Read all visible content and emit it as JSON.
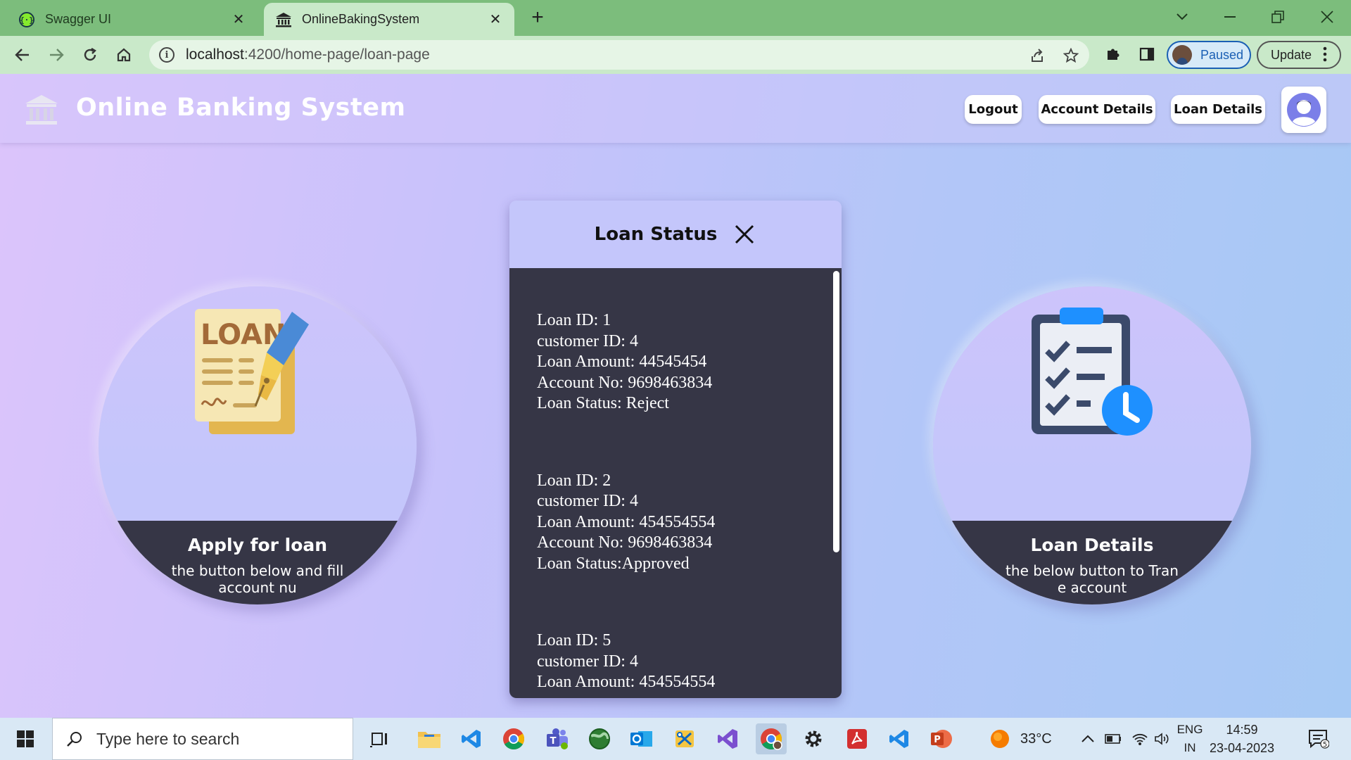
{
  "browser": {
    "tabs": [
      {
        "title": "Swagger UI",
        "active": false
      },
      {
        "title": "OnlineBakingSystem",
        "active": true
      }
    ],
    "url_host": "localhost",
    "url_path": ":4200/home-page/loan-page",
    "profile_label": "Paused",
    "update_label": "Update"
  },
  "app": {
    "title": "Online Banking System",
    "nav": {
      "logout": "Logout",
      "account_details": "Account Details",
      "loan_details": "Loan Details"
    }
  },
  "cards": {
    "apply": {
      "art_text": "LOAN",
      "title": "Apply for loan",
      "desc_line1": "the button below and fill",
      "desc_line2": "account nu"
    },
    "details": {
      "title": "Loan Details",
      "desc_line1": "the below button to Tran",
      "desc_line2": "e account"
    }
  },
  "modal": {
    "title": "Loan Status",
    "records": [
      {
        "loan_id": "Loan ID: 1",
        "customer_id": "customer ID: 4",
        "amount": "Loan Amount: 44545454",
        "account_no": "Account No: 9698463834",
        "status": "Loan Status: Reject"
      },
      {
        "loan_id": "Loan ID: 2",
        "customer_id": "customer ID: 4",
        "amount": "Loan Amount: 454554554",
        "account_no": "Account No: 9698463834",
        "status": "Loan Status:Approved"
      },
      {
        "loan_id": "Loan ID: 5",
        "customer_id": "customer ID: 4",
        "amount": "Loan Amount: 454554554",
        "account_no": "",
        "status": ""
      }
    ]
  },
  "taskbar": {
    "search_placeholder": "Type here to search",
    "weather": "33°C",
    "lang_line1": "ENG",
    "lang_line2": "IN",
    "time": "14:59",
    "date": "23-04-2023",
    "notification_count": "5"
  },
  "colors": {
    "browser_frame": "#7cbd7c",
    "toolbar": "#c9e9c9",
    "card_band": "#363646",
    "modal_header": "#c4c6fb"
  }
}
